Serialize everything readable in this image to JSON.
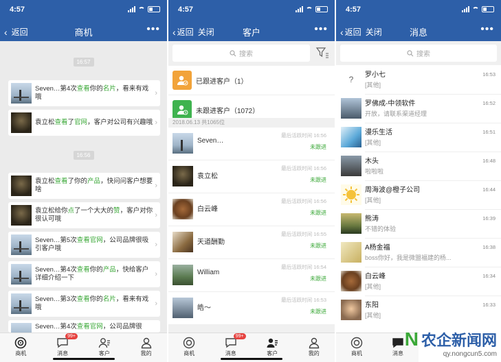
{
  "colors": {
    "nav": "#2d5fa8",
    "accent_green": "#3ba838",
    "badge_red": "#e64340",
    "group_orange": "#f2a33a",
    "group_green": "#3fb34f"
  },
  "status": {
    "time": "4:57"
  },
  "panel1": {
    "back": "返回",
    "title": "商机",
    "stamps": [
      "16:57",
      "16:56"
    ],
    "cards": [
      {
        "pre": "Seven…第4次",
        "hl": "查看",
        "mid": "你的",
        "hl2": "名片",
        "post": "，看来有戏哦"
      },
      {
        "pre": "袁立松",
        "hl": "查看",
        "mid": "了",
        "hl2": "官网",
        "post": "，客户对公司有兴趣哦"
      },
      {
        "pre": "袁立松",
        "hl": "查看",
        "mid": "了你的",
        "hl2": "产品",
        "post": "，快问问客户想要啥"
      },
      {
        "pre": "袁立松给你",
        "hl": "点",
        "mid": "了一个大大的",
        "hl2": "赞",
        "post": "，客户对你很认可哦"
      },
      {
        "pre": "Seven…第5次",
        "hl": "查看",
        "mid": "",
        "hl2": "官网",
        "post": "，公司品牌很吸引客户哦"
      },
      {
        "pre": "Seven…第4次",
        "hl": "查看",
        "mid": "你的",
        "hl2": "产品",
        "post": "，快给客户详细介绍一下"
      },
      {
        "pre": "Seven…第3次",
        "hl": "查看",
        "mid": "你的",
        "hl2": "名片",
        "post": "，看来有戏哦"
      },
      {
        "pre": "Seven…第4次",
        "hl": "查看",
        "mid": "",
        "hl2": "官网",
        "post": "，公司品牌很"
      }
    ],
    "tabs": [
      {
        "label": "商机",
        "icon": "target-icon"
      },
      {
        "label": "消息",
        "icon": "chat-icon",
        "badge": "99+"
      },
      {
        "label": "客户",
        "icon": "customers-icon"
      },
      {
        "label": "我的",
        "icon": "person-icon"
      }
    ]
  },
  "panel2": {
    "back": "返回",
    "close": "关闭",
    "title": "客户",
    "search_placeholder": "搜索",
    "groups": [
      {
        "label": "已跟进客户（1）"
      },
      {
        "label": "未跟进客户（1072）"
      }
    ],
    "date_header": "2018.06.13 共1065位",
    "customers": [
      {
        "name": "Seven…",
        "last": "最后活跃时间 16:56",
        "status": "未跟进"
      },
      {
        "name": "袁立松",
        "last": "最后活跃时间 16:56",
        "status": "未跟进"
      },
      {
        "name": "白云峰",
        "last": "最后活跃时间 16:56",
        "status": "未跟进"
      },
      {
        "name": "天道酬勤",
        "last": "最后活跃时间 16:55",
        "status": "未跟进"
      },
      {
        "name": "William",
        "last": "最后活跃时间 16:54",
        "status": "未跟进"
      },
      {
        "name": "皓～",
        "last": "最后活跃时间 16:53",
        "status": "未跟进"
      }
    ],
    "tabs": [
      {
        "label": "商机"
      },
      {
        "label": "消息",
        "badge": "99+"
      },
      {
        "label": "客户"
      },
      {
        "label": "我的"
      }
    ]
  },
  "panel3": {
    "back": "返回",
    "close": "关闭",
    "title": "消息",
    "search_placeholder": "搜索",
    "messages": [
      {
        "name": "罗小七",
        "sub": "[其他]",
        "time": "16:53"
      },
      {
        "name": "罗佛成-中领软件",
        "sub": "开放，请联系渠道经理",
        "time": "16:52"
      },
      {
        "name": "漫乐生活",
        "sub": "[其他]",
        "time": "16:51"
      },
      {
        "name": "木头",
        "sub": "啦啦啦",
        "time": "16:48"
      },
      {
        "name": "周海波@橙子公司",
        "sub": "[其他]",
        "time": "16:44"
      },
      {
        "name": "熊涛",
        "sub": "不错的体验",
        "time": "16:39"
      },
      {
        "name": "A杨金福",
        "sub": "boss你好，我是微盟福建的杨...",
        "time": "16:38"
      },
      {
        "name": "白云峰",
        "sub": "[其他]",
        "time": "16:34"
      },
      {
        "name": "东阳",
        "sub": "[其他]",
        "time": "16:33"
      }
    ],
    "tabs": [
      {
        "label": "商机"
      },
      {
        "label": "消息"
      }
    ]
  },
  "watermark": {
    "text": "农企新闻网",
    "url": "qy.nongcun5.com"
  }
}
